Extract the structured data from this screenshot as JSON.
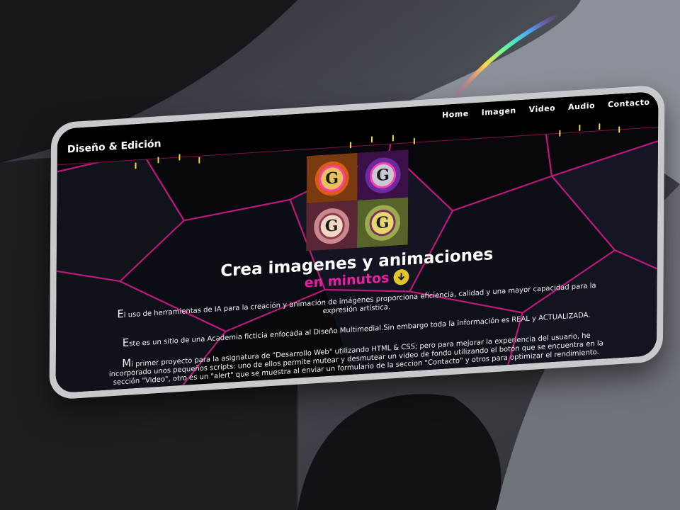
{
  "site": {
    "brand": "Diseño & Edición",
    "nav": [
      "Home",
      "Imagen",
      "Video",
      "Audio",
      "Contacto"
    ]
  },
  "hero": {
    "logo_letter": "G",
    "headline": "Crea imagenes y animaciones",
    "subline": "en minutos",
    "download_icon": "arrow-down-circle-icon"
  },
  "paragraphs": [
    {
      "first": "E",
      "rest": "l uso de herramientas de IA para la creación y animación de imágenes proporciona eficiencia, calidad y una mayor capacidad para la expresión artística."
    },
    {
      "first": "E",
      "rest": "ste es un sitio de una Academia ficticia enfocada al Diseño Multimedial.Sin embargo toda la información es REAL y ACTUALIZADA."
    },
    {
      "first": "M",
      "rest": "i primer proyecto para la asignatura de \"Desarrollo Web\" utilizando HTML & CSS; pero para mejorar la experiencia del usuario, he incorporado unos pequeños scripts: uno de ellos permite mutear y desmutear un video de fondo utilizando el botón que se encuentra en la sección \"Video\", otro es un \"alert\" que se muestra al enviar un formulario de la seccion \"Contacto\" y otros para optimizar el rendimiento."
    }
  ],
  "colors": {
    "accent_pink": "#e91ea2",
    "accent_yellow": "#e1c52a",
    "navbar": "#000000"
  }
}
